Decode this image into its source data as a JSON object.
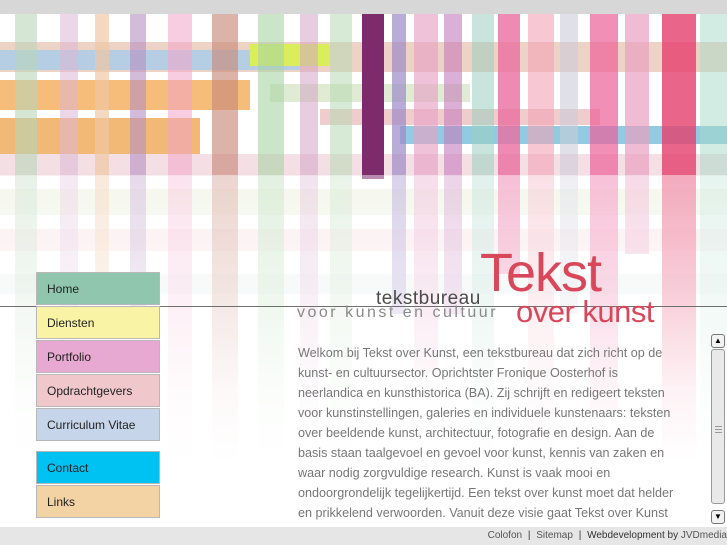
{
  "logo": {
    "small": "tekstbureau",
    "big": "Tekst",
    "tagline": "voor kunst en cultuur",
    "over": "over kunst"
  },
  "nav": {
    "items": [
      {
        "label": "Home",
        "color": "#8fc6ad"
      },
      {
        "label": "Diensten",
        "color": "#f8f3a5"
      },
      {
        "label": "Portfolio",
        "color": "#e7a8d2"
      },
      {
        "label": "Opdrachtgevers",
        "color": "#f0c8cc"
      },
      {
        "label": "Curriculum Vitae",
        "color": "#c7d5ea"
      },
      {
        "label": "Contact",
        "color": "#00c2f2"
      },
      {
        "label": "Links",
        "color": "#f3d2a3"
      }
    ]
  },
  "content": {
    "text": "Welkom bij Tekst over Kunst, een tekstbureau dat zich richt op de kunst- en cultuursector. Oprichtster Fronique Oosterhof is neerlandica en kunsthistorica (BA). Zij schrijft en redigeert teksten voor kunstinstellingen, galeries en individuele kunstenaars: teksten over beeldende kunst, architectuur, fotografie en design. Aan de basis staan taalgevoel en gevoel voor kunst, kennis van zaken en waar nodig zorgvuldige research. Kunst is vaak mooi en ondoorgrondelijk tegelijkertijd. Een tekst over kunst moet dat helder en prikkelend verwoorden. Vanuit deze visie gaat Tekst over Kunst graag voor u aan de slag."
  },
  "scrollbar": {
    "position": 0.0
  },
  "footer": {
    "colofon": "Colofon",
    "sep": "|",
    "sitemap": "Sitemap",
    "webdev": "Webdevelopment by",
    "credit": "JVDmedia"
  }
}
